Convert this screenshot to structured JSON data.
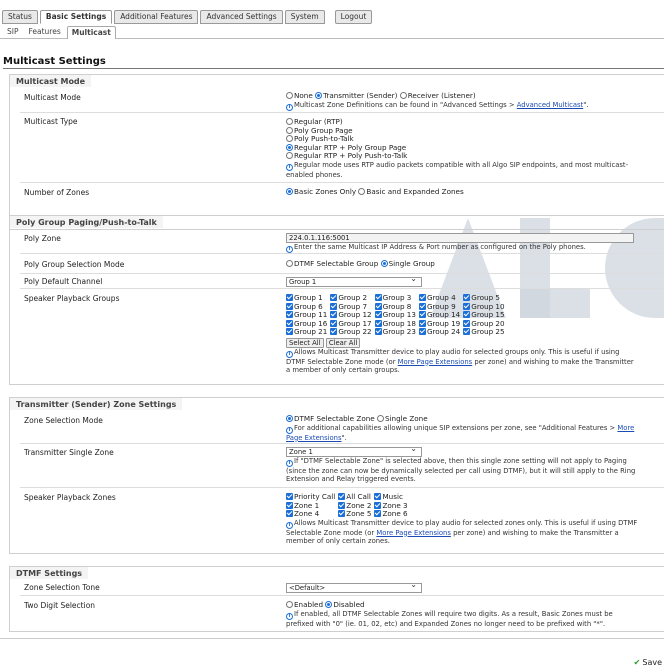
{
  "topTabs": [
    "Status",
    "Basic Settings",
    "Additional Features",
    "Advanced Settings",
    "System",
    "Logout"
  ],
  "subTabs": [
    "SIP",
    "Features",
    "Multicast"
  ],
  "pageTitle": "Multicast Settings",
  "sections": {
    "mode": {
      "heading": "Multicast Mode",
      "multicastMode": {
        "label": "Multicast Mode",
        "options": [
          "None",
          "Transmitter (Sender)",
          "Receiver (Listener)"
        ],
        "selected": "Transmitter (Sender)",
        "hintPrefix": "Multicast Zone Definitions can be found in \"Advanced Settings > ",
        "hintLink": "Advanced Multicast",
        "hintSuffix": "\"."
      },
      "multicastType": {
        "label": "Multicast Type",
        "options": [
          "Regular (RTP)",
          "Poly Group Page",
          "Poly Push-to-Talk",
          "Regular RTP + Poly Group Page",
          "Regular RTP + Poly Push-to-Talk"
        ],
        "selected": "Regular RTP + Poly Group Page",
        "hint": "Regular mode uses RTP audio packets compatible with all Algo SIP endpoints, and most multicast-enabled phones."
      },
      "numberOfZones": {
        "label": "Number of Zones",
        "options": [
          "Basic Zones Only",
          "Basic and Expanded Zones"
        ],
        "selected": "Basic Zones Only"
      }
    },
    "poly": {
      "heading": "Poly Group Paging/Push-to-Talk",
      "polyZone": {
        "label": "Poly Zone",
        "value": "224.0.1.116:5001",
        "hint": "Enter the same Multicast IP Address & Port number as configured on the Poly phones."
      },
      "groupSelectionMode": {
        "label": "Poly Group Selection Mode",
        "options": [
          "DTMF Selectable Group",
          "Single Group"
        ],
        "selected": "Single Group"
      },
      "defaultChannel": {
        "label": "Poly Default Channel",
        "value": "Group 1"
      },
      "speakerGroups": {
        "label": "Speaker Playback Groups",
        "groups": [
          "Group 1",
          "Group 2",
          "Group 3",
          "Group 4",
          "Group 5",
          "Group 6",
          "Group 7",
          "Group 8",
          "Group 9",
          "Group 10",
          "Group 11",
          "Group 12",
          "Group 13",
          "Group 14",
          "Group 15",
          "Group 16",
          "Group 17",
          "Group 18",
          "Group 19",
          "Group 20",
          "Group 21",
          "Group 22",
          "Group 23",
          "Group 24",
          "Group 25"
        ],
        "selectAll": "Select All",
        "clearAll": "Clear All",
        "hintPrefix": "Allows Multicast Transmitter device to play audio for selected groups only. This is useful if using DTMF Selectable Zone mode (or ",
        "hintLink": "More Page Extensions",
        "hintSuffix": " per zone) and wishing to make the Transmitter a member of only certain groups."
      }
    },
    "transmitter": {
      "heading": "Transmitter (Sender) Zone Settings",
      "zoneSelectionMode": {
        "label": "Zone Selection Mode",
        "options": [
          "DTMF Selectable Zone",
          "Single Zone"
        ],
        "selected": "DTMF Selectable Zone",
        "hintPrefix": "For additional capabilities allowing unique SIP extensions per zone, see \"Additional Features > ",
        "hintLink": "More Page Extensions",
        "hintSuffix": "\"."
      },
      "singleZone": {
        "label": "Transmitter Single Zone",
        "value": "Zone 1",
        "hint": "If \"DTMF Selectable Zone\" is selected above, then this single zone setting will not apply to Paging (since the zone can now be dynamically selected per call using DTMF), but it will still apply to the Ring Extension and Relay triggered events."
      },
      "speakerZones": {
        "label": "Speaker Playback Zones",
        "zones": [
          "Priority Call",
          "All Call",
          "Music",
          "Zone 1",
          "Zone 2",
          "Zone 3",
          "Zone 4",
          "Zone 5",
          "Zone 6"
        ],
        "hintPrefix": "Allows Multicast Transmitter device to play audio for selected zones only. This is useful if using DTMF Selectable Zone mode (or ",
        "hintLink": "More Page Extensions",
        "hintSuffix": " per zone) and wishing to make the Transmitter a member of only certain zones."
      }
    },
    "dtmf": {
      "heading": "DTMF Settings",
      "zoneSelectionTone": {
        "label": "Zone Selection Tone",
        "value": "<Default>"
      },
      "twoDigit": {
        "label": "Two Digit Selection",
        "options": [
          "Enabled",
          "Disabled"
        ],
        "selected": "Disabled",
        "hint": "If enabled, all DTMF Selectable Zones will require two digits. As a result, Basic Zones must be prefixed with \"0\" (ie. 01, 02, etc) and Expanded Zones no longer need to be prefixed with \"*\"."
      }
    }
  },
  "saveLabel": "Save",
  "accentColor": "#1b6fd6"
}
